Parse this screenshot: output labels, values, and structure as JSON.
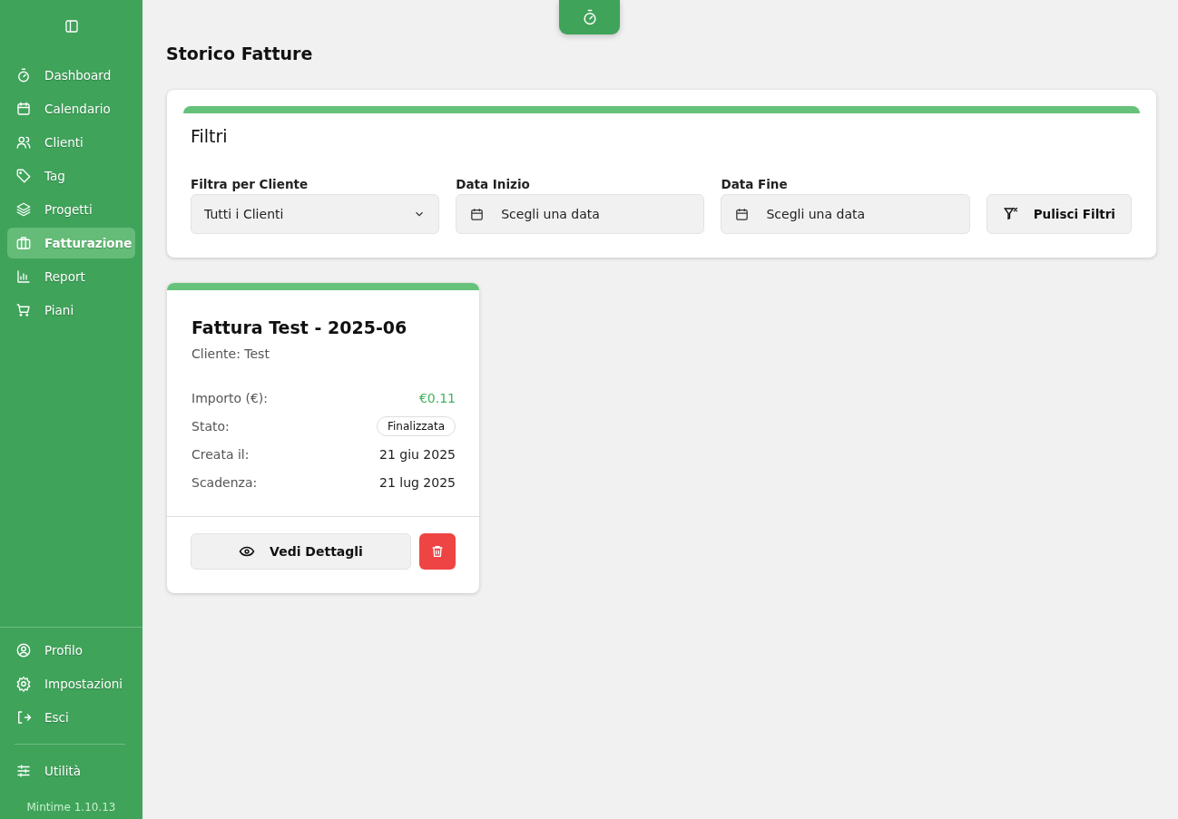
{
  "sidebar": {
    "nav": [
      {
        "label": "Dashboard",
        "kind": "stopwatch",
        "selected": false
      },
      {
        "label": "Calendario",
        "kind": "calendar",
        "selected": false
      },
      {
        "label": "Clienti",
        "kind": "users",
        "selected": false
      },
      {
        "label": "Tag",
        "kind": "tag",
        "selected": false
      },
      {
        "label": "Progetti",
        "kind": "layers",
        "selected": false
      },
      {
        "label": "Fatturazione",
        "kind": "briefcase",
        "selected": true
      },
      {
        "label": "Report",
        "kind": "chart",
        "selected": false
      },
      {
        "label": "Piani",
        "kind": "cart",
        "selected": false
      }
    ],
    "bottom": [
      {
        "label": "Profilo",
        "kind": "user-circle",
        "selected": false
      },
      {
        "label": "Impostazioni",
        "kind": "gear",
        "selected": false
      },
      {
        "label": "Esci",
        "kind": "logout",
        "selected": false
      }
    ],
    "utility": [
      {
        "label": "Utilità",
        "kind": "sliders",
        "selected": false
      }
    ],
    "version": "Mintime 1.10.13"
  },
  "title": "Storico Fatture",
  "filters": {
    "title": "Filtri",
    "client": {
      "label": "Filtra per Cliente",
      "value": "Tutti i Clienti"
    },
    "start": {
      "label": "Data Inizio",
      "placeholder": "Scegli una data"
    },
    "end": {
      "label": "Data Fine",
      "placeholder": "Scegli una data"
    },
    "clear_button": "Pulisci Filtri"
  },
  "invoices": [
    {
      "title": "Fattura Test - 2025-06",
      "client": "Cliente: Test",
      "rows": [
        {
          "label": "Importo (€):",
          "value": "€0.11",
          "kind": "amount"
        },
        {
          "label": "Stato:",
          "value": "Finalizzata",
          "kind": "badge"
        },
        {
          "label": "Creata il:",
          "value": "21 giu 2025",
          "kind": "text"
        },
        {
          "label": "Scadenza:",
          "value": "21 lug 2025",
          "kind": "text"
        }
      ],
      "details_button": "Vedi Dettagli"
    }
  ]
}
